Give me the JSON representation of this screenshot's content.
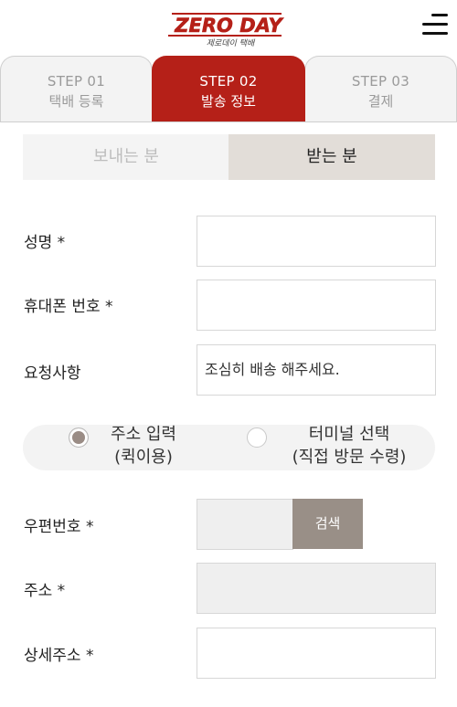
{
  "header": {
    "logo_text": "ZERO DAY",
    "logo_subtext": "제로데이 택배",
    "menu_icon": "hamburger-menu-icon"
  },
  "steps": [
    {
      "num": "STEP 01",
      "label": "택배 등록",
      "active": false
    },
    {
      "num": "STEP 02",
      "label": "발송 정보",
      "active": true
    },
    {
      "num": "STEP 03",
      "label": "결제",
      "active": false
    }
  ],
  "tabs": {
    "sender": "보내는 분",
    "receiver": "받는 분",
    "active": "receiver"
  },
  "form": {
    "name_label": "성명 *",
    "name_value": "",
    "phone_label": "휴대폰 번호 *",
    "phone_value": "",
    "request_label": "요청사항",
    "request_value": "조심히 배송 해주세요.",
    "address_mode": {
      "option1_line1": "주소 입력",
      "option1_line2": "(퀵이용)",
      "option2_line1": "터미널 선택",
      "option2_line2": "(직접 방문 수령)",
      "selected": "option1"
    },
    "postcode_label": "우편번호 *",
    "postcode_value": "",
    "search_button": "검색",
    "address_label": "주소 *",
    "address_value": "",
    "detail_label": "상세주소 *",
    "detail_value": ""
  },
  "colors": {
    "brand_red": "#b52018",
    "active_tab_bg": "#e2ddd8",
    "button_gray": "#998f87"
  }
}
